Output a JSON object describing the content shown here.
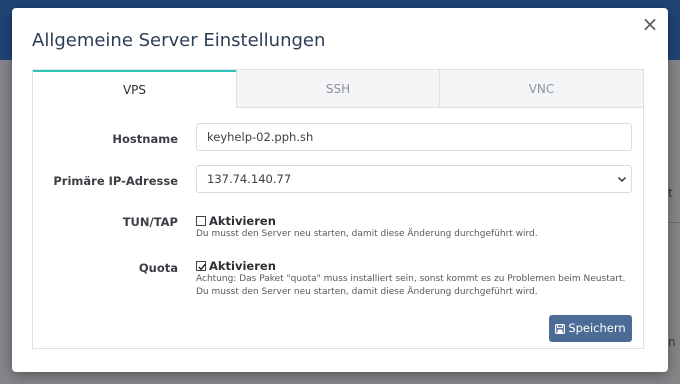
{
  "modal": {
    "title": "Allgemeine Server Einstellungen",
    "close_glyph": "×"
  },
  "tabs": [
    {
      "label": "VPS",
      "active": true
    },
    {
      "label": "SSH",
      "active": false
    },
    {
      "label": "VNC",
      "active": false
    }
  ],
  "form": {
    "hostname": {
      "label": "Hostname",
      "value": "keyhelp-02.pph.sh"
    },
    "primary_ip": {
      "label": "Primäre IP-Adresse",
      "selected": "137.74.140.77"
    },
    "tun_tap": {
      "label": "TUN/TAP",
      "checkbox_label": "Aktivieren",
      "checked": false,
      "help": "Du musst den Server neu starten, damit diese Änderung durchgeführt wird."
    },
    "quota": {
      "label": "Quota",
      "checkbox_label": "Aktivieren",
      "checked": true,
      "help": "Achtung: Das Paket \"quota\" muss installiert sein, sonst kommt es zu Problemen beim Neustart. Du musst den Server neu starten, damit diese Änderung durchgeführt wird."
    },
    "save_label": "Speichern"
  },
  "icons": {
    "close": "close-icon",
    "select": "chevron-down-icon",
    "save": "floppy-disk-icon",
    "check": "checkmark-icon"
  },
  "background": {
    "right_edge_text_1": "t",
    "right_edge_text_2": "n"
  },
  "colors": {
    "accent_tab": "#2ec4b6",
    "button": "#4c6b96",
    "header": "#1f4475"
  }
}
